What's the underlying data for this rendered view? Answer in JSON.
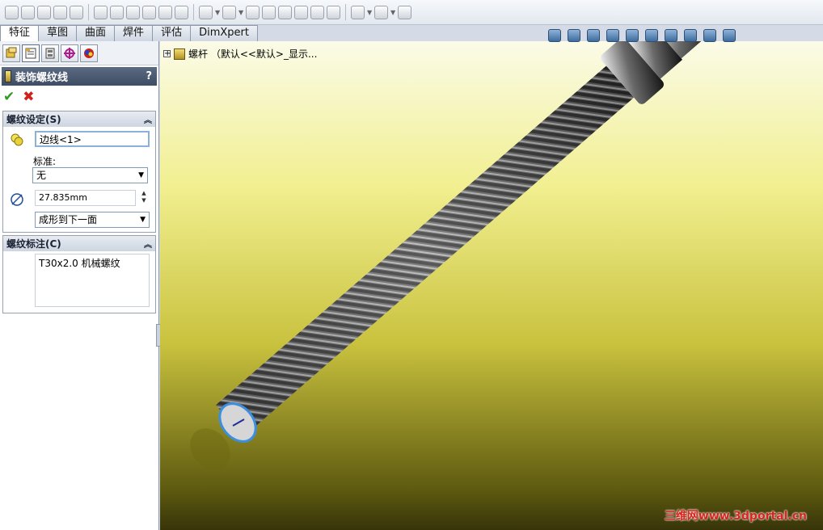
{
  "tabs": [
    "特征",
    "草图",
    "曲面",
    "焊件",
    "评估",
    "DimXpert"
  ],
  "active_tab": "特征",
  "tree": {
    "label": "螺杆 （默认<<默认>_显示..."
  },
  "pm": {
    "title": "装饰螺纹线",
    "help": "?",
    "ok_icon": "check-icon",
    "cancel_icon": "x-icon",
    "settings": {
      "header": "螺纹设定(S)",
      "edge_value": "边线<1>",
      "standard_label": "标准:",
      "standard_value": "无",
      "diameter_value": "27.835mm",
      "end_condition": "成形到下一面"
    },
    "callout": {
      "header": "螺纹标注(C)",
      "text": "T30x2.0 机械螺纹"
    }
  },
  "watermark": "三维网www.3dportal.cn",
  "colors": {
    "viewport_top": "#fbfbe8",
    "viewport_mid": "#c9c23e",
    "viewport_bottom": "#37340a",
    "title_bar": "#4a5a72"
  }
}
